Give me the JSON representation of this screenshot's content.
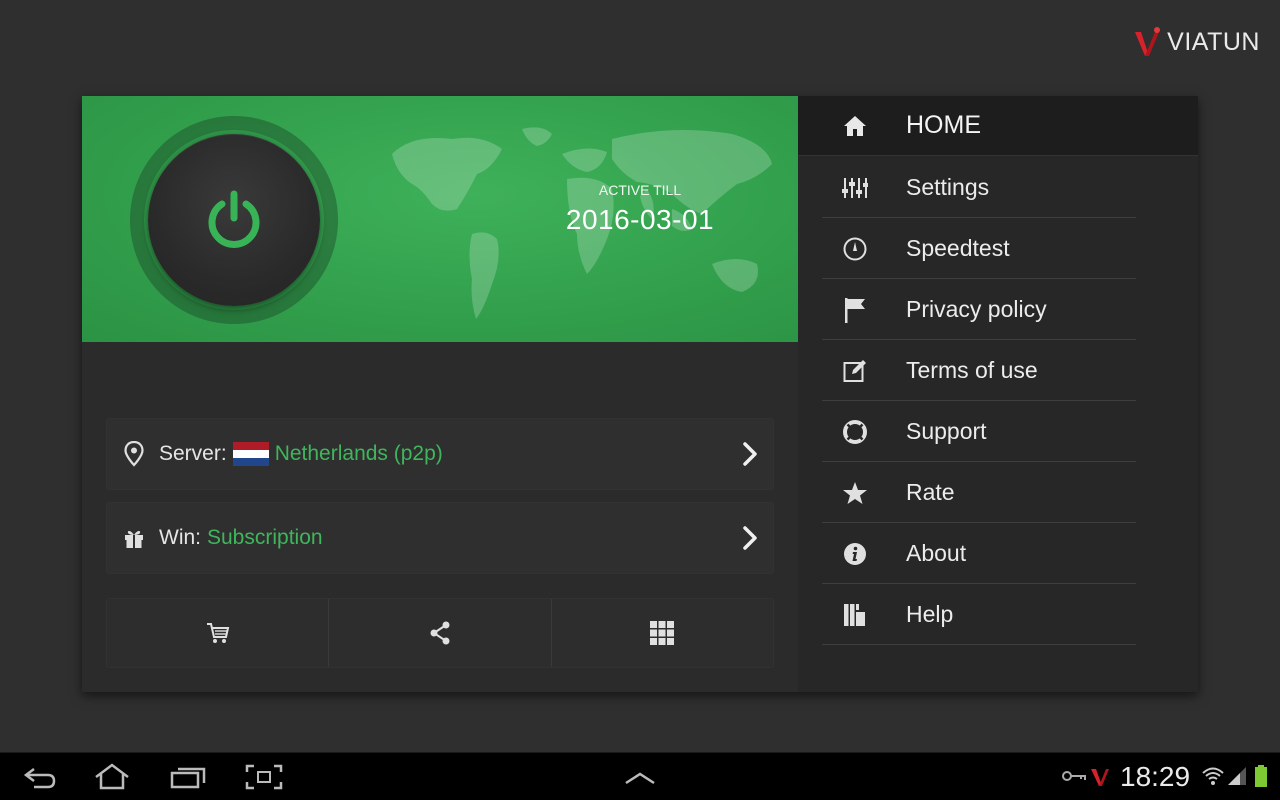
{
  "brand": {
    "name": "VIATUN"
  },
  "hero": {
    "active_label": "ACTIVE TILL",
    "active_date": "2016-03-01",
    "accent_color": "#33a04d"
  },
  "server": {
    "label": "Server:",
    "value": "Netherlands (p2p)",
    "flag_colors": [
      "#ae1c28",
      "#ffffff",
      "#21468b"
    ]
  },
  "win": {
    "label": "Win:",
    "value": "Subscription"
  },
  "actions": [
    {
      "icon": "cart-icon"
    },
    {
      "icon": "share-icon"
    },
    {
      "icon": "grid-icon"
    }
  ],
  "menu": {
    "home": {
      "label": "HOME",
      "icon": "home-icon"
    },
    "items": [
      {
        "label": "Settings",
        "icon": "sliders-icon"
      },
      {
        "label": "Speedtest",
        "icon": "gauge-icon"
      },
      {
        "label": "Privacy policy",
        "icon": "flag-icon"
      },
      {
        "label": "Terms of use",
        "icon": "edit-icon"
      },
      {
        "label": "Support",
        "icon": "lifebuoy-icon"
      },
      {
        "label": "Rate",
        "icon": "star-icon"
      },
      {
        "label": "About",
        "icon": "info-icon"
      },
      {
        "label": "Help",
        "icon": "book-icon"
      }
    ]
  },
  "statusbar": {
    "time": "18:29"
  },
  "colors": {
    "highlight": "#3fb65c",
    "background": "#2f2f2f"
  }
}
